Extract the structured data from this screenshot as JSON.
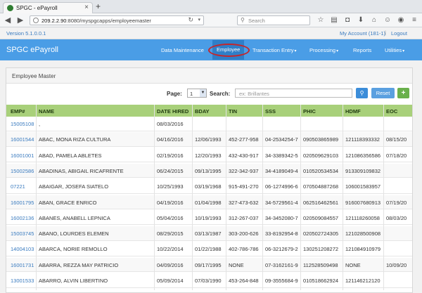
{
  "browser": {
    "tab_title": "SPGC - ePayroll",
    "url_host": "209.2.2.90",
    "url_rest": ":8080/myspgcapps/employeemaster",
    "search_placeholder": "Search"
  },
  "app": {
    "version": "Version 5.1.0.0.1",
    "account": "My Account (181-1)",
    "separator": "|",
    "logout": "Logout",
    "brand": "SPGC ePayroll",
    "menu": [
      {
        "label": "Data Maintenance",
        "caret": ""
      },
      {
        "label": "Employee",
        "caret": ""
      },
      {
        "label": "Transaction Entry",
        "caret": "▾"
      },
      {
        "label": "Processing",
        "caret": "▾"
      },
      {
        "label": "Reports",
        "caret": ""
      },
      {
        "label": "Utilities",
        "caret": "▾"
      }
    ],
    "active_menu": "Employee",
    "highlight_color": "#c4262b",
    "header_color": "#4a9de6",
    "table_header_color": "#a8d07a"
  },
  "panel": {
    "title": "Employee Master",
    "page_label": "Page:",
    "page_value": "1",
    "search_label": "Search:",
    "search_placeholder": "ex: Brillantes",
    "reset_label": "Reset",
    "add_label": "+"
  },
  "table": {
    "columns": [
      "EMP#",
      "NAME",
      "DATE HIRED",
      "BDAY",
      "TIN",
      "SSS",
      "PHIC",
      "HDMF",
      "EOC"
    ],
    "rows": [
      [
        "15005108",
        ",",
        "08/03/2016",
        "",
        "",
        "",
        "",
        "",
        ""
      ],
      [
        "16001544",
        "ABAC, MONA RIZA CULTURA",
        "04/16/2016",
        "12/06/1993",
        "452-277-958",
        "04-2534254-7",
        "090503865989",
        "121118393332",
        "08/15/20"
      ],
      [
        "16001001",
        "ABAD, PAMELA ABLETES",
        "02/19/2016",
        "12/20/1993",
        "432-430-917",
        "34-3389342-5",
        "020509629103",
        "121086356586",
        "07/18/20"
      ],
      [
        "15002586",
        "ABADINAS, ABIGAIL RICAFRENTE",
        "06/24/2015",
        "09/13/1995",
        "322-342-937",
        "34-4189049-4",
        "010520534534",
        "913309109832",
        ""
      ],
      [
        "07221",
        "ABAIGAR, JOSEFA SIATELO",
        "10/25/1993",
        "03/19/1968",
        "915-491-270",
        "06-1274996-6",
        "070504887268",
        "106001583957",
        ""
      ],
      [
        "16001795",
        "ABAN, GRACE ENRICO",
        "04/19/2016",
        "01/04/1998",
        "327-473-632",
        "34-5729561-4",
        "062516462561",
        "916007680913",
        "07/19/20"
      ],
      [
        "16002136",
        "ABANES, ANABELL LEPNICA",
        "05/04/2016",
        "10/19/1993",
        "312-267-037",
        "34-3452080-7",
        "020509084557",
        "121118260058",
        "08/03/20"
      ],
      [
        "15003745",
        "ABANO, LOURDES ELEMEN",
        "08/29/2015",
        "03/13/1987",
        "303-200-626",
        "33-8192954-8",
        "020502724305",
        "121028500908",
        ""
      ],
      [
        "14004103",
        "ABARCA, NORIE REMOLLO",
        "10/22/2014",
        "01/22/1988",
        "402-786-786",
        "06-3212679-2",
        "130251208272",
        "121084910979",
        ""
      ],
      [
        "16001731",
        "ABARRA, REZZA MAY PATRICIO",
        "04/09/2016",
        "09/17/1995",
        "NONE",
        "07-3162161-9",
        "112528509498",
        "NONE",
        "10/09/20"
      ],
      [
        "13001533",
        "ABARRO, ALVIN LIBERTINO",
        "05/09/2014",
        "07/03/1990",
        "453-264-848",
        "09-3555684-9",
        "010518662924",
        "121146212120",
        ""
      ]
    ]
  }
}
